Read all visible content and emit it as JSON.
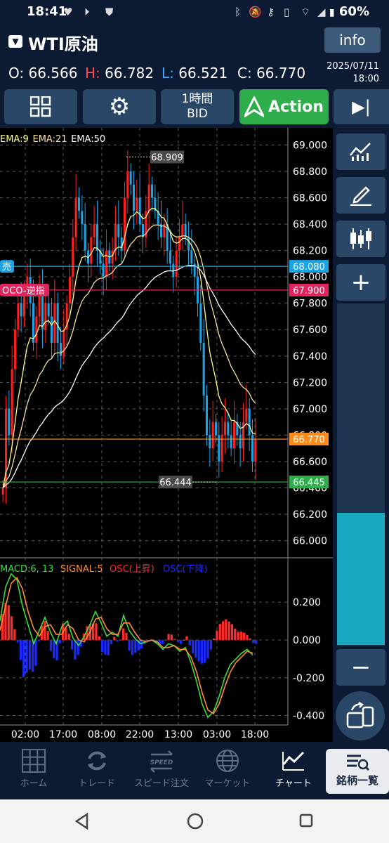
{
  "status_bar": {
    "time": "18:41",
    "battery": "60%"
  },
  "header": {
    "symbol": "WTI原油",
    "info_label": "info"
  },
  "ohlc": {
    "o_label": "O:",
    "o_value": "66.566",
    "h_label": "H:",
    "h_value": "66.782",
    "l_label": "L:",
    "l_value": "66.521",
    "c_label": "C:",
    "c_value": "66.770",
    "date": "2025/07/11",
    "time": "18:00"
  },
  "toolbar": {
    "interval": "1時間",
    "price_type": "BID",
    "action_label": "Action"
  },
  "colors": {
    "up": "#ff1e1e",
    "down": "#1aa4e6",
    "ema9": "#ffff8a",
    "ema21": "#f5e29b",
    "ema50": "#ffffff",
    "macd": "#3ddc3d",
    "signal": "#ff8c3a",
    "osc_up": "#ff2a2a",
    "osc_down": "#1a2aff"
  },
  "chart_data": [
    {
      "type": "candlestick",
      "indicator_labels": [
        "EMA:9",
        "EMA:21",
        "EMA:50"
      ],
      "x_ticks": [
        "02:00",
        "17:00",
        "08:00",
        "22:00",
        "13:00",
        "03:00",
        "18:00"
      ],
      "ylim": [
        65.87,
        69.13
      ],
      "y_ticks": [
        "69.000",
        "68.800",
        "68.600",
        "68.400",
        "68.200",
        "68.000",
        "67.800",
        "67.600",
        "67.400",
        "67.200",
        "67.000",
        "66.800",
        "66.600",
        "66.400",
        "66.200",
        "66.000"
      ],
      "high_marker": "68.909",
      "low_marker": "66.444",
      "lines": [
        {
          "label": "売",
          "value": 68.08,
          "price_label": "68.080",
          "color": "#1aa4e6"
        },
        {
          "label": "OCO-逆指",
          "value": 67.9,
          "price_label": "67.900",
          "color": "#e0245e"
        },
        {
          "label": "",
          "value": 66.77,
          "price_label": "66.770",
          "color": "#ff8c1a"
        },
        {
          "label": "",
          "value": 66.445,
          "price_label": "66.445",
          "color": "#2dae4a"
        }
      ],
      "close_path": [
        66.4,
        67.0,
        66.8,
        67.3,
        67.6,
        67.8,
        67.7,
        67.9,
        68.0,
        67.8,
        67.5,
        67.7,
        67.9,
        67.6,
        67.8,
        67.7,
        67.5,
        67.8,
        67.5,
        67.4,
        67.6,
        67.8,
        68.0,
        68.3,
        68.6,
        68.5,
        68.4,
        68.2,
        68.1,
        68.3,
        68.4,
        68.2,
        68.1,
        68.0,
        68.2,
        68.1,
        68.2,
        68.4,
        68.3,
        68.2,
        68.6,
        68.8,
        68.7,
        68.5,
        68.6,
        68.4,
        68.3,
        68.5,
        68.7,
        68.6,
        68.5,
        68.4,
        68.3,
        68.4,
        68.2,
        68.1,
        68.0,
        68.2,
        68.3,
        68.4,
        68.3,
        68.2,
        68.1,
        68.0,
        67.8,
        67.5,
        67.1,
        66.8,
        66.7,
        66.9,
        66.8,
        66.6,
        66.8,
        66.9,
        66.8,
        66.7,
        66.9,
        66.8,
        66.7,
        66.9,
        67.0,
        66.8,
        66.6,
        66.77
      ],
      "ema9_end": 67.02,
      "ema21_end": 67.02,
      "ema50_end": 67.4
    },
    {
      "type": "macd",
      "indicator_labels": [
        "MACD:6, 13",
        "SIGNAL:5",
        "OSC(上昇)",
        "OSC(下降)"
      ],
      "ylim": [
        -0.45,
        0.42
      ],
      "y_ticks": [
        "0.200",
        "0.000",
        "-0.200",
        "-0.400"
      ],
      "macd_keys": [
        [
          0,
          0.1
        ],
        [
          8,
          0.28
        ],
        [
          16,
          0.35
        ],
        [
          24,
          0.32
        ],
        [
          32,
          0.18
        ],
        [
          40,
          0.08
        ],
        [
          48,
          -0.02
        ],
        [
          56,
          0.05
        ],
        [
          64,
          0.12
        ],
        [
          72,
          0.04
        ],
        [
          80,
          -0.02
        ],
        [
          88,
          0.07
        ],
        [
          96,
          0.1
        ],
        [
          104,
          0.01
        ],
        [
          112,
          -0.03
        ],
        [
          120,
          0.02
        ],
        [
          128,
          0.08
        ],
        [
          136,
          0.15
        ],
        [
          144,
          0.09
        ],
        [
          152,
          0.02
        ],
        [
          160,
          0.04
        ],
        [
          168,
          0.02
        ],
        [
          176,
          0.13
        ],
        [
          184,
          0.05
        ],
        [
          192,
          0.01
        ],
        [
          200,
          -0.02
        ],
        [
          208,
          -0.01
        ],
        [
          216,
          0.0
        ],
        [
          224,
          -0.02
        ],
        [
          232,
          -0.05
        ],
        [
          240,
          -0.02
        ],
        [
          248,
          -0.03
        ],
        [
          256,
          -0.06
        ],
        [
          264,
          -0.04
        ],
        [
          272,
          -0.12
        ],
        [
          280,
          -0.22
        ],
        [
          288,
          -0.34
        ],
        [
          296,
          -0.41
        ],
        [
          304,
          -0.38
        ],
        [
          312,
          -0.3
        ],
        [
          320,
          -0.2
        ],
        [
          328,
          -0.13
        ],
        [
          336,
          -0.1
        ],
        [
          344,
          -0.07
        ],
        [
          352,
          -0.05
        ],
        [
          360,
          -0.08
        ]
      ],
      "signal_keys": [
        [
          0,
          0.05
        ],
        [
          8,
          0.18
        ],
        [
          16,
          0.3
        ],
        [
          24,
          0.33
        ],
        [
          32,
          0.27
        ],
        [
          40,
          0.15
        ],
        [
          48,
          0.06
        ],
        [
          56,
          0.02
        ],
        [
          64,
          0.07
        ],
        [
          72,
          0.08
        ],
        [
          80,
          0.03
        ],
        [
          88,
          0.03
        ],
        [
          96,
          0.08
        ],
        [
          104,
          0.06
        ],
        [
          112,
          0.0
        ],
        [
          120,
          -0.01
        ],
        [
          128,
          0.04
        ],
        [
          136,
          0.11
        ],
        [
          144,
          0.12
        ],
        [
          152,
          0.06
        ],
        [
          160,
          0.03
        ],
        [
          168,
          0.03
        ],
        [
          176,
          0.09
        ],
        [
          184,
          0.09
        ],
        [
          192,
          0.04
        ],
        [
          200,
          0.0
        ],
        [
          208,
          -0.01
        ],
        [
          216,
          0.0
        ],
        [
          224,
          -0.01
        ],
        [
          232,
          -0.04
        ],
        [
          240,
          -0.04
        ],
        [
          248,
          -0.03
        ],
        [
          256,
          -0.05
        ],
        [
          264,
          -0.05
        ],
        [
          272,
          -0.09
        ],
        [
          280,
          -0.17
        ],
        [
          288,
          -0.28
        ],
        [
          296,
          -0.37
        ],
        [
          304,
          -0.39
        ],
        [
          312,
          -0.34
        ],
        [
          320,
          -0.25
        ],
        [
          328,
          -0.17
        ],
        [
          336,
          -0.12
        ],
        [
          344,
          -0.09
        ],
        [
          352,
          -0.06
        ],
        [
          360,
          -0.07
        ]
      ]
    }
  ],
  "side_tools": [
    "chart-type-icon",
    "draw-icon",
    "candle-icon",
    "plus-icon",
    "minus-icon",
    "rotate-screen-icon"
  ],
  "nav": {
    "items": [
      {
        "label": "ホーム"
      },
      {
        "label": "トレード"
      },
      {
        "label": "スピード注文"
      },
      {
        "label": "マーケット"
      },
      {
        "label": "チャート"
      },
      {
        "label": "銘柄一覧"
      }
    ],
    "speed_icon_text": "SPEED"
  }
}
